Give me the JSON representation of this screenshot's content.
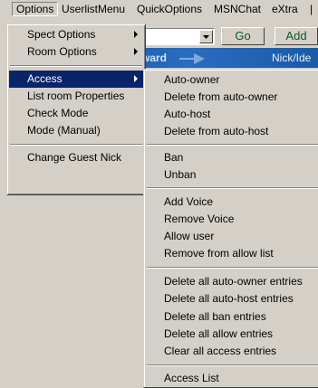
{
  "menubar": {
    "items": [
      "Options",
      "UserlistMenu",
      "QuickOptions",
      "MSNChat",
      "eXtra",
      "|"
    ]
  },
  "background": {
    "go_label": "Go",
    "add_label": "Add",
    "forward_label": "ward",
    "nick_label": "Nick/Ide"
  },
  "options_menu": {
    "items": [
      "Spect Options",
      "Room Options",
      "Access",
      "List room Properties",
      "Check Mode",
      "Mode (Manual)",
      "Change Guest Nick"
    ]
  },
  "access_menu": {
    "items": [
      "Auto-owner",
      "Delete from auto-owner",
      "Auto-host",
      "Delete from auto-host",
      "Ban",
      "Unban",
      "Add Voice",
      "Remove Voice",
      "Allow user",
      "Remove from allow list",
      "Delete all auto-owner entries",
      "Delete all auto-host entries",
      "Delete all ban entries",
      "Delete all allow entries",
      "Clear all access entries",
      "Access List"
    ]
  },
  "colors": {
    "menu_face": "#d4d0c8",
    "highlight": "#0a246a",
    "toolbar_blue": "#1a5aa6",
    "button_text": "#0a5a2a"
  }
}
